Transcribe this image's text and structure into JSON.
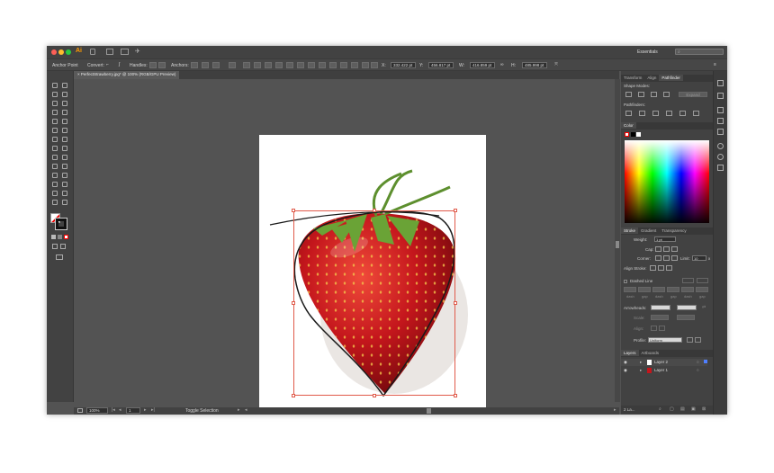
{
  "app": {
    "logo": "Ai",
    "workspace": "Essentials",
    "search_placeholder": ""
  },
  "control_bar": {
    "anchor_point_label": "Anchor Point",
    "convert_label": "Convert:",
    "handles_label": "Handles:",
    "anchors_label": "Anchors:",
    "x_label": "X:",
    "x_value": "332.422 pt",
    "y_label": "Y:",
    "y_value": "456.817 pt",
    "w_label": "W:",
    "w_value": "416.859 pt",
    "h_label": "H:",
    "h_value": "485.998 pt"
  },
  "document": {
    "tab_title": "PerfectStrawberry.jpg* @ 100% (RGB/GPU Preview)"
  },
  "status_bar": {
    "zoom": "100%",
    "artboard_number": "1",
    "status_text": "Toggle Selection"
  },
  "panels": {
    "top_tabs": [
      "Transform",
      "Align",
      "Pathfinder"
    ],
    "shape_modes_label": "Shape Modes:",
    "expand_label": "Expand",
    "pathfinders_label": "Pathfinders:",
    "color_tab": "Color",
    "stroke_tabs": [
      "Stroke",
      "Gradient",
      "Transparency"
    ],
    "weight_label": "Weight:",
    "weight_value": "1 pt",
    "cap_label": "Cap:",
    "corner_label": "Corner:",
    "limit_label": "Limit:",
    "limit_value": "10",
    "limit_suffix": "x",
    "align_stroke_label": "Align Stroke:",
    "dashed_line_label": "Dashed Line",
    "dash_labels": [
      "dash",
      "gap",
      "dash",
      "gap",
      "dash",
      "gap"
    ],
    "arrowheads_label": "Arrowheads:",
    "scale_label": "Scale:",
    "align_label": "Align:",
    "profile_label": "Profile:",
    "profile_value": "Uniform",
    "layers_tabs": [
      "Layers",
      "Artboards"
    ],
    "layers": [
      {
        "name": "Layer 2",
        "color": "#4f7fff"
      },
      {
        "name": "Layer 1",
        "color": "#ff4040"
      }
    ],
    "layers_count": "2 La..."
  },
  "colors": {
    "selection": "#e05a4a",
    "path": "#1a1a1a",
    "strawberry": "#c4161c",
    "leaf": "#5d8f2e"
  }
}
